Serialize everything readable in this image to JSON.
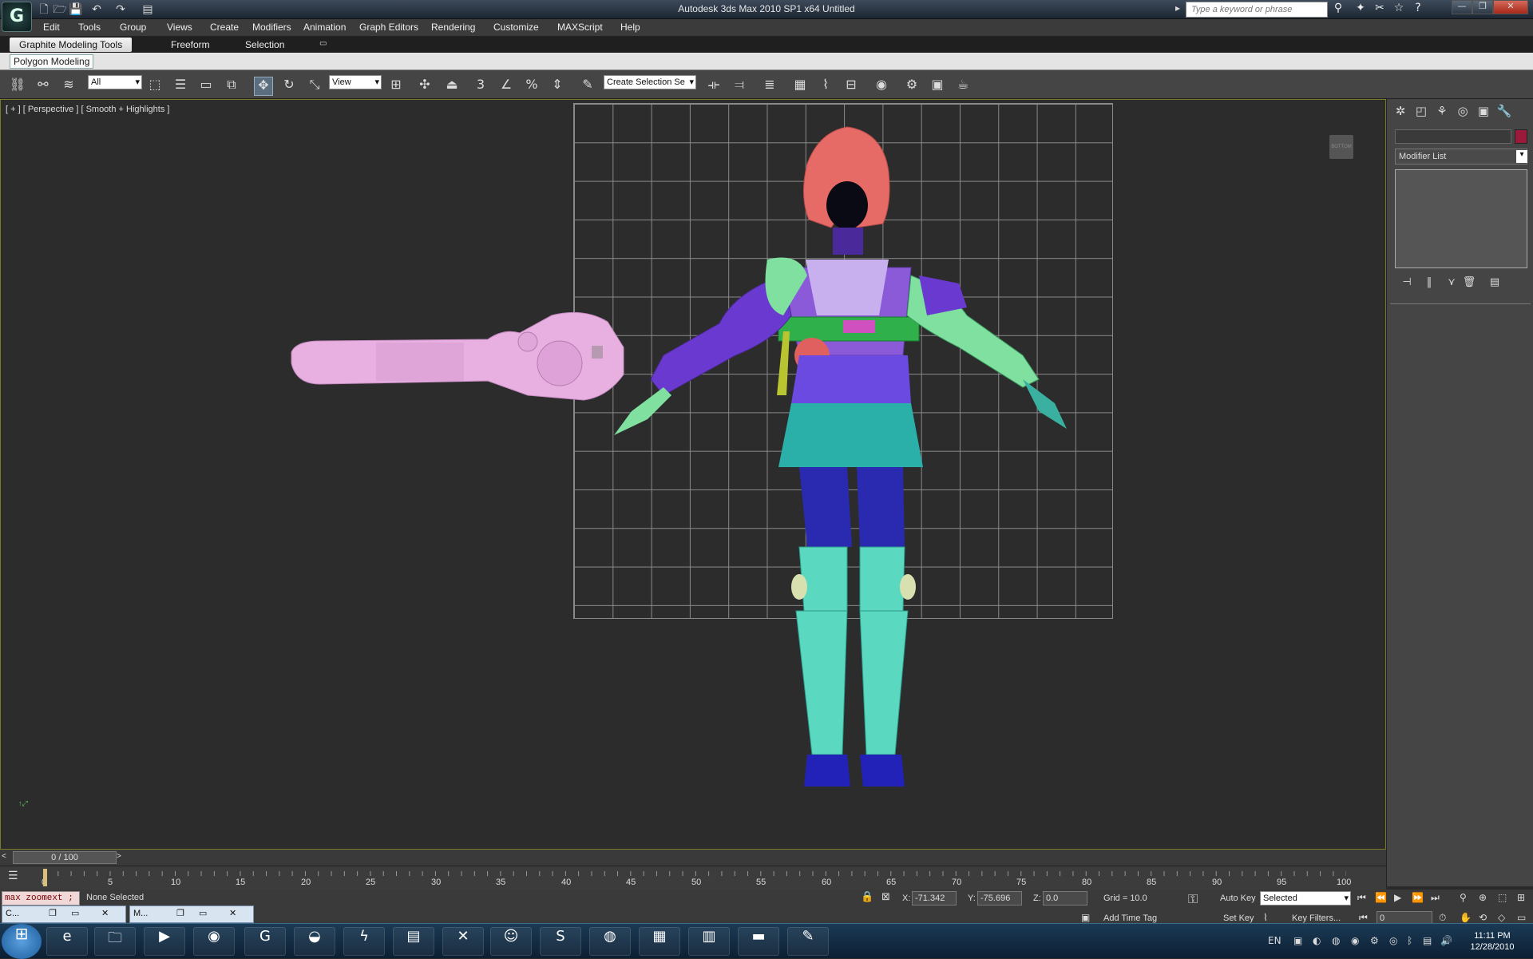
{
  "window": {
    "title": "Autodesk 3ds Max  2010 SP1 x64      Untitled",
    "search_placeholder": "Type a keyword or phrase"
  },
  "menubar": [
    "Edit",
    "Tools",
    "Group",
    "Views",
    "Create",
    "Modifiers",
    "Animation",
    "Graph Editors",
    "Rendering",
    "Customize",
    "MAXScript",
    "Help"
  ],
  "ribbon": {
    "tabs": [
      "Graphite Modeling Tools",
      "Freeform",
      "Selection"
    ],
    "panel": "Polygon Modeling"
  },
  "toolbar": {
    "filter": "All",
    "refcoord": "View",
    "selset_placeholder": "Create Selection Se"
  },
  "viewport": {
    "label": "[ + ] [ Perspective ] [ Smooth + Highlights ]",
    "viewcube": "BOTTOM"
  },
  "cmdpanel": {
    "modifier_list": "Modifier List",
    "object_color": "#9a1a3c"
  },
  "timeline": {
    "frame": "0 / 100",
    "ticks": [
      "0",
      "5",
      "10",
      "15",
      "20",
      "25",
      "30",
      "35",
      "40",
      "45",
      "50",
      "55",
      "60",
      "65",
      "70",
      "75",
      "80",
      "85",
      "90",
      "95",
      "100"
    ]
  },
  "status": {
    "maxscript": "max zoomext ;",
    "selection": "None Selected",
    "x_label": "X:",
    "x": "-71.342",
    "y_label": "Y:",
    "y": "-75.696",
    "z_label": "Z:",
    "z": "0.0",
    "grid": "Grid = 10.0",
    "add_time_tag": "Add Time Tag",
    "auto_key": "Auto Key",
    "set_key": "Set Key",
    "key_mode": "Selected",
    "key_filters": "Key Filters...",
    "frame_spinner": "0"
  },
  "mdi": [
    "C...",
    "M..."
  ],
  "taskbar": {
    "lang": "EN",
    "time": "11:11 PM",
    "date": "12/28/2010"
  }
}
